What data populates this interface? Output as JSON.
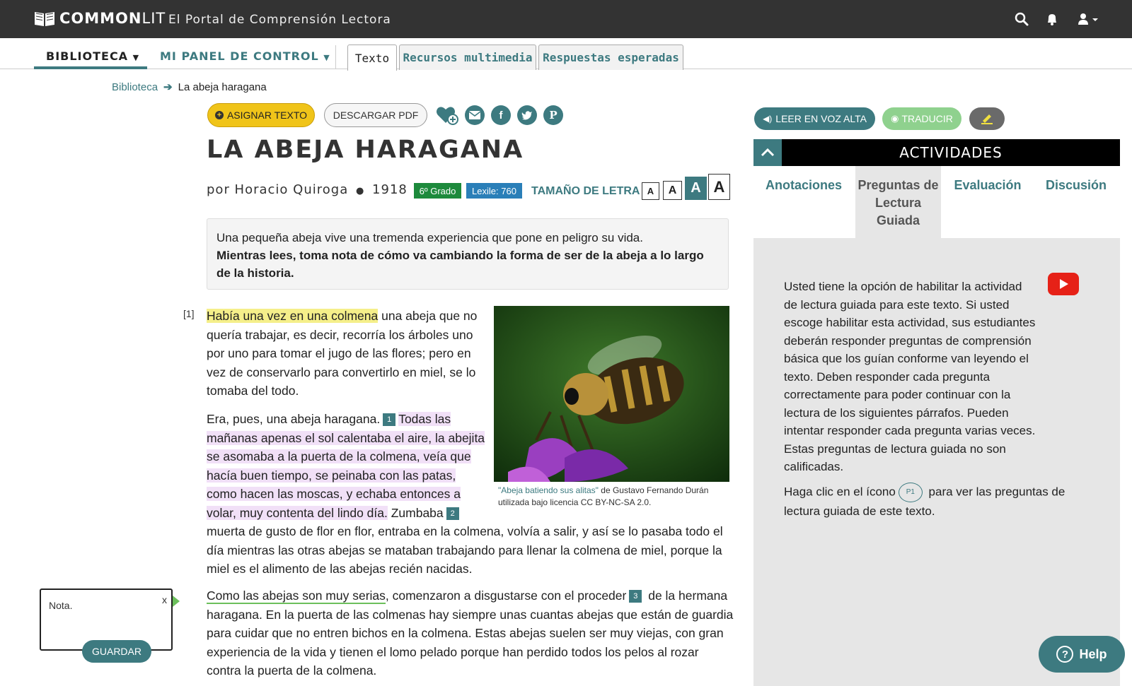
{
  "header": {
    "brand_main": "COMMON",
    "brand_lit": "LIT",
    "tagline": "El Portal de Comprensión Lectora"
  },
  "nav": {
    "library": "BIBLIOTECA",
    "panel": "MI PANEL DE CONTROL",
    "tabs": [
      {
        "label": "Texto",
        "active": true
      },
      {
        "label": "Recursos multimedia",
        "active": false
      },
      {
        "label": "Respuestas esperadas",
        "active": false
      }
    ]
  },
  "breadcrumb": {
    "root": "Biblioteca",
    "current": "La abeja haragana"
  },
  "toolbar": {
    "assign": "ASIGNAR TEXTO",
    "pdf": "DESCARGAR PDF"
  },
  "article": {
    "title": "LA ABEJA HARAGANA",
    "byline": "por Horacio Quiroga",
    "dot": "●",
    "year": "1918",
    "grade": "6º Grado",
    "lexile": "Lexile: 760",
    "font_size_label": "TAMAÑO DE LETRA",
    "font_sizes": [
      "A",
      "A",
      "A",
      "A"
    ],
    "intro_line": "Una pequeña abeja vive una tremenda experiencia que pone en peligro su vida.",
    "intro_question": "Mientras lees, toma nota de cómo va cambiando la forma de ser de la abeja a lo largo de la historia.",
    "paragraph_number": "[1]",
    "p1_highlight": "Había una vez en una colmena",
    "p1_rest": " una abeja que no",
    "p1_lines": [
      "quería trabajar, es decir, recorría los árboles uno",
      "por uno para tomar el jugo de las flores; pero en",
      "vez de conservarlo para convertirlo en miel, se lo",
      "tomaba del todo."
    ],
    "p2_start": "Era, pues, una abeja haragana.",
    "q1": "1",
    "p2_hl_first": "Todas las",
    "p2_hl_lines": [
      "mañanas apenas el sol calentaba el aire, la abejita",
      "se asomaba a la puerta de la colmena, veía que",
      "hacía buen tiempo, se peinaba con las patas,",
      "como hacen las moscas, y echaba entonces a"
    ],
    "p2_hl_last": "volar, muy contenta del lindo día.",
    "p2_after": " Zumbaba",
    "q2": "2",
    "p2_rest": [
      "muerta de gusto de flor en flor, entraba en la colmena, volvía a salir, y así se lo pasaba todo el",
      "día mientras las otras abejas se mataban trabajando para llenar la colmena de miel, porque la",
      "miel es el alimento de las abejas recién nacidas."
    ],
    "p3_underline": "Como las abejas son muy serias",
    "p3_mid": ", comenzaron a disgustarse con el proceder",
    "q3": "3",
    "p3_after": " de la hermana",
    "p3_rest": [
      "haragana. En la puerta de las colmenas hay siempre unas cuantas abejas que están de guardia",
      "para cuidar que no entren bichos en la colmena. Estas abejas suelen ser muy viejas, con gran",
      "experiencia de la vida y tienen el lomo pelado porque han perdido todos los pelos al rozar",
      "contra la puerta de la colmena."
    ],
    "caption_link": "\"Abeja batiendo sus alitas\"",
    "caption_rest": " de Gustavo Fernando Durán utilizada bajo licencia CC BY-NC-SA 2.0."
  },
  "right": {
    "read_aloud": "LEER EN VOZ ALTA",
    "translate": "TRADUCIR",
    "activities_title": "ACTIVIDADES",
    "tabs": [
      {
        "label": "Anotaciones",
        "active": false
      },
      {
        "label": "Preguntas de Lectura Guiada",
        "active": true
      },
      {
        "label": "Evaluación",
        "active": false
      },
      {
        "label": "Discusión",
        "active": false
      }
    ],
    "panel_text": "Usted tiene la opción de habilitar la actividad de lectura guiada para este texto. Si usted escoge habilitar esta actividad, sus estudiantes deberán responder preguntas de comprensión básica que los guían conforme van leyendo el texto. Deben responder cada pregunta correctamente para poder continuar con la lectura de los siguientes párrafos. Pueden intentar responder cada pregunta varias veces. Estas preguntas de lectura guiada no son calificadas.",
    "click_before": "Haga clic en el ícono",
    "p1_icon": "P1",
    "click_after": " para ver las preguntas de lectura guiada de este texto."
  },
  "note": {
    "placeholder": "Nota.",
    "close": "x",
    "save": "GUARDAR"
  },
  "help": {
    "icon": "?",
    "label": "Help"
  },
  "colors": {
    "accent": "#3d7a80",
    "assign": "#f0c419",
    "grade": "#1d8a3c",
    "lexile": "#2a7fb8",
    "translate": "#8fd18e"
  },
  "icons": [
    "book-icon",
    "search-icon",
    "bell-icon",
    "user-icon",
    "heart-plus-icon",
    "email-icon",
    "facebook-icon",
    "twitter-icon",
    "pinterest-icon",
    "speaker-icon",
    "globe-icon",
    "highlighter-icon",
    "youtube-icon"
  ]
}
